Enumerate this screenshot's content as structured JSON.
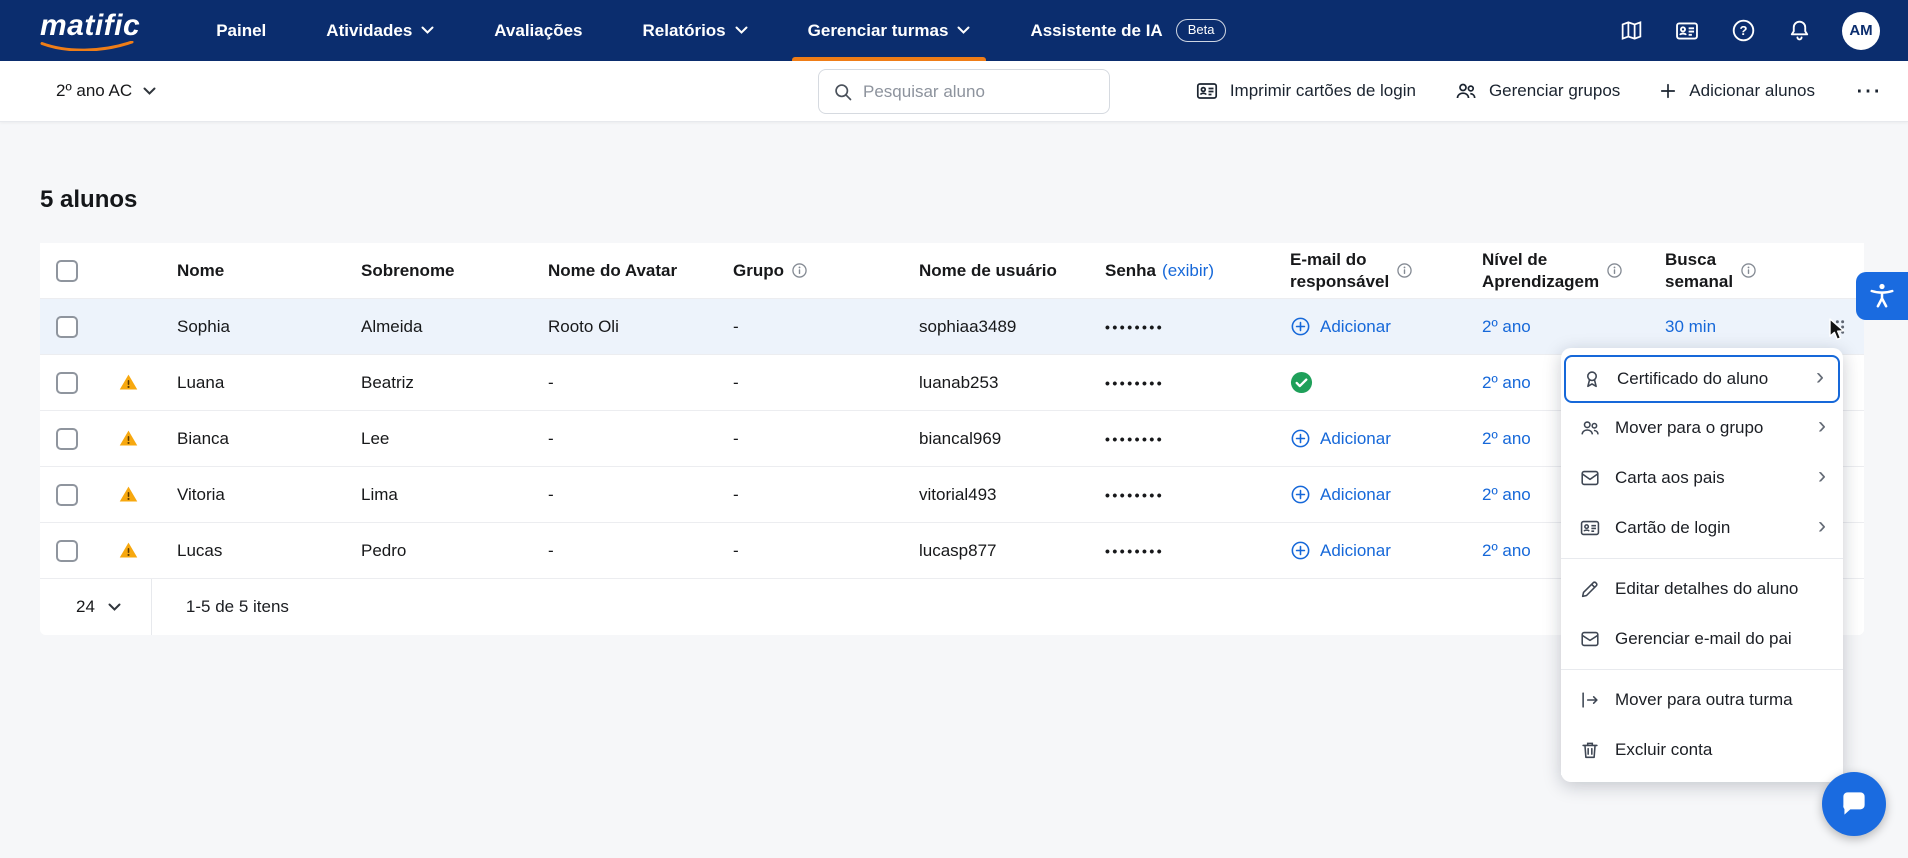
{
  "navbar": {
    "logo": "matific",
    "items": [
      {
        "label": "Painel",
        "dropdown": false,
        "active": false
      },
      {
        "label": "Atividades",
        "dropdown": true,
        "active": false
      },
      {
        "label": "Avaliações",
        "dropdown": false,
        "active": false
      },
      {
        "label": "Relatórios",
        "dropdown": true,
        "active": false
      },
      {
        "label": "Gerenciar turmas",
        "dropdown": true,
        "active": true
      },
      {
        "label": "Assistente de IA",
        "dropdown": false,
        "active": false,
        "badge": "Beta"
      }
    ],
    "avatar_initials": "AM"
  },
  "toolbar": {
    "class_selector_label": "2º ano AC",
    "search_placeholder": "Pesquisar aluno",
    "buttons": {
      "print_login_cards": "Imprimir cartões de login",
      "manage_groups": "Gerenciar grupos",
      "add_students": "Adicionar alunos"
    }
  },
  "main": {
    "students_count_title": "5 alunos",
    "table": {
      "headers": {
        "name": "Nome",
        "surname": "Sobrenome",
        "avatar_name": "Nome do Avatar",
        "group": "Grupo",
        "username": "Nome de usuário",
        "password": "Senha",
        "password_show": "(exibir)",
        "guardian_email_line1": "E-mail do",
        "guardian_email_line2": "responsável",
        "learning_level_line1": "Nível de",
        "learning_level_line2": "Aprendizagem",
        "weekly_search_line1": "Busca",
        "weekly_search_line2": "semanal"
      },
      "password_mask": "••••••••",
      "add_email_label": "Adicionar",
      "rows": [
        {
          "name": "Sophia",
          "surname": "Almeida",
          "avatar_name": "Rooto Oli",
          "group": "-",
          "username": "sophiaa3489",
          "email_status": "add",
          "level": "2º ano",
          "weekly": "30 min",
          "warning": false,
          "highlighted": true
        },
        {
          "name": "Luana",
          "surname": "Beatriz",
          "avatar_name": "-",
          "group": "-",
          "username": "luanab253",
          "email_status": "verified",
          "level": "2º ano",
          "warning": true
        },
        {
          "name": "Bianca",
          "surname": "Lee",
          "avatar_name": "-",
          "group": "-",
          "username": "biancal969",
          "email_status": "add",
          "level": "2º ano",
          "warning": true
        },
        {
          "name": "Vitoria",
          "surname": "Lima",
          "avatar_name": "-",
          "group": "-",
          "username": "vitorial493",
          "email_status": "add",
          "level": "2º ano",
          "warning": true
        },
        {
          "name": "Lucas",
          "surname": "Pedro",
          "avatar_name": "-",
          "group": "-",
          "username": "lucasp877",
          "email_status": "add",
          "level": "2º ano",
          "warning": true
        }
      ]
    },
    "pagination": {
      "page_size": "24",
      "range_info": "1-5 de 5 itens"
    }
  },
  "context_menu": {
    "items": [
      {
        "label": "Certificado do aluno",
        "icon": "certificate-icon",
        "chevron": true,
        "focused": true
      },
      {
        "label": "Mover para o grupo",
        "icon": "group-icon",
        "chevron": true,
        "focused": false
      },
      {
        "label": "Carta aos pais",
        "icon": "letter-icon",
        "chevron": true,
        "focused": false
      },
      {
        "label": "Cartão de login",
        "icon": "login-card-icon",
        "chevron": true,
        "focused": false
      },
      {
        "label": "Editar detalhes do aluno",
        "icon": "pencil-icon",
        "chevron": false,
        "focused": false
      },
      {
        "label": "Gerenciar e-mail do pai",
        "icon": "mail-icon",
        "chevron": false,
        "focused": false
      },
      {
        "label": "Mover para outra turma",
        "icon": "move-icon",
        "chevron": false,
        "focused": false
      },
      {
        "label": "Excluir conta",
        "icon": "trash-icon",
        "chevron": false,
        "focused": false
      }
    ]
  },
  "icons": {
    "more_horizontal": "⋯",
    "chevron_right": "›"
  },
  "colors": {
    "navbar_bg": "#0b2d6e",
    "accent_orange": "#ef7d17",
    "link_blue": "#1668d9",
    "row_highlight": "#edf3fb",
    "success_green": "#1fa05a",
    "warning_amber": "#f7a80f"
  }
}
